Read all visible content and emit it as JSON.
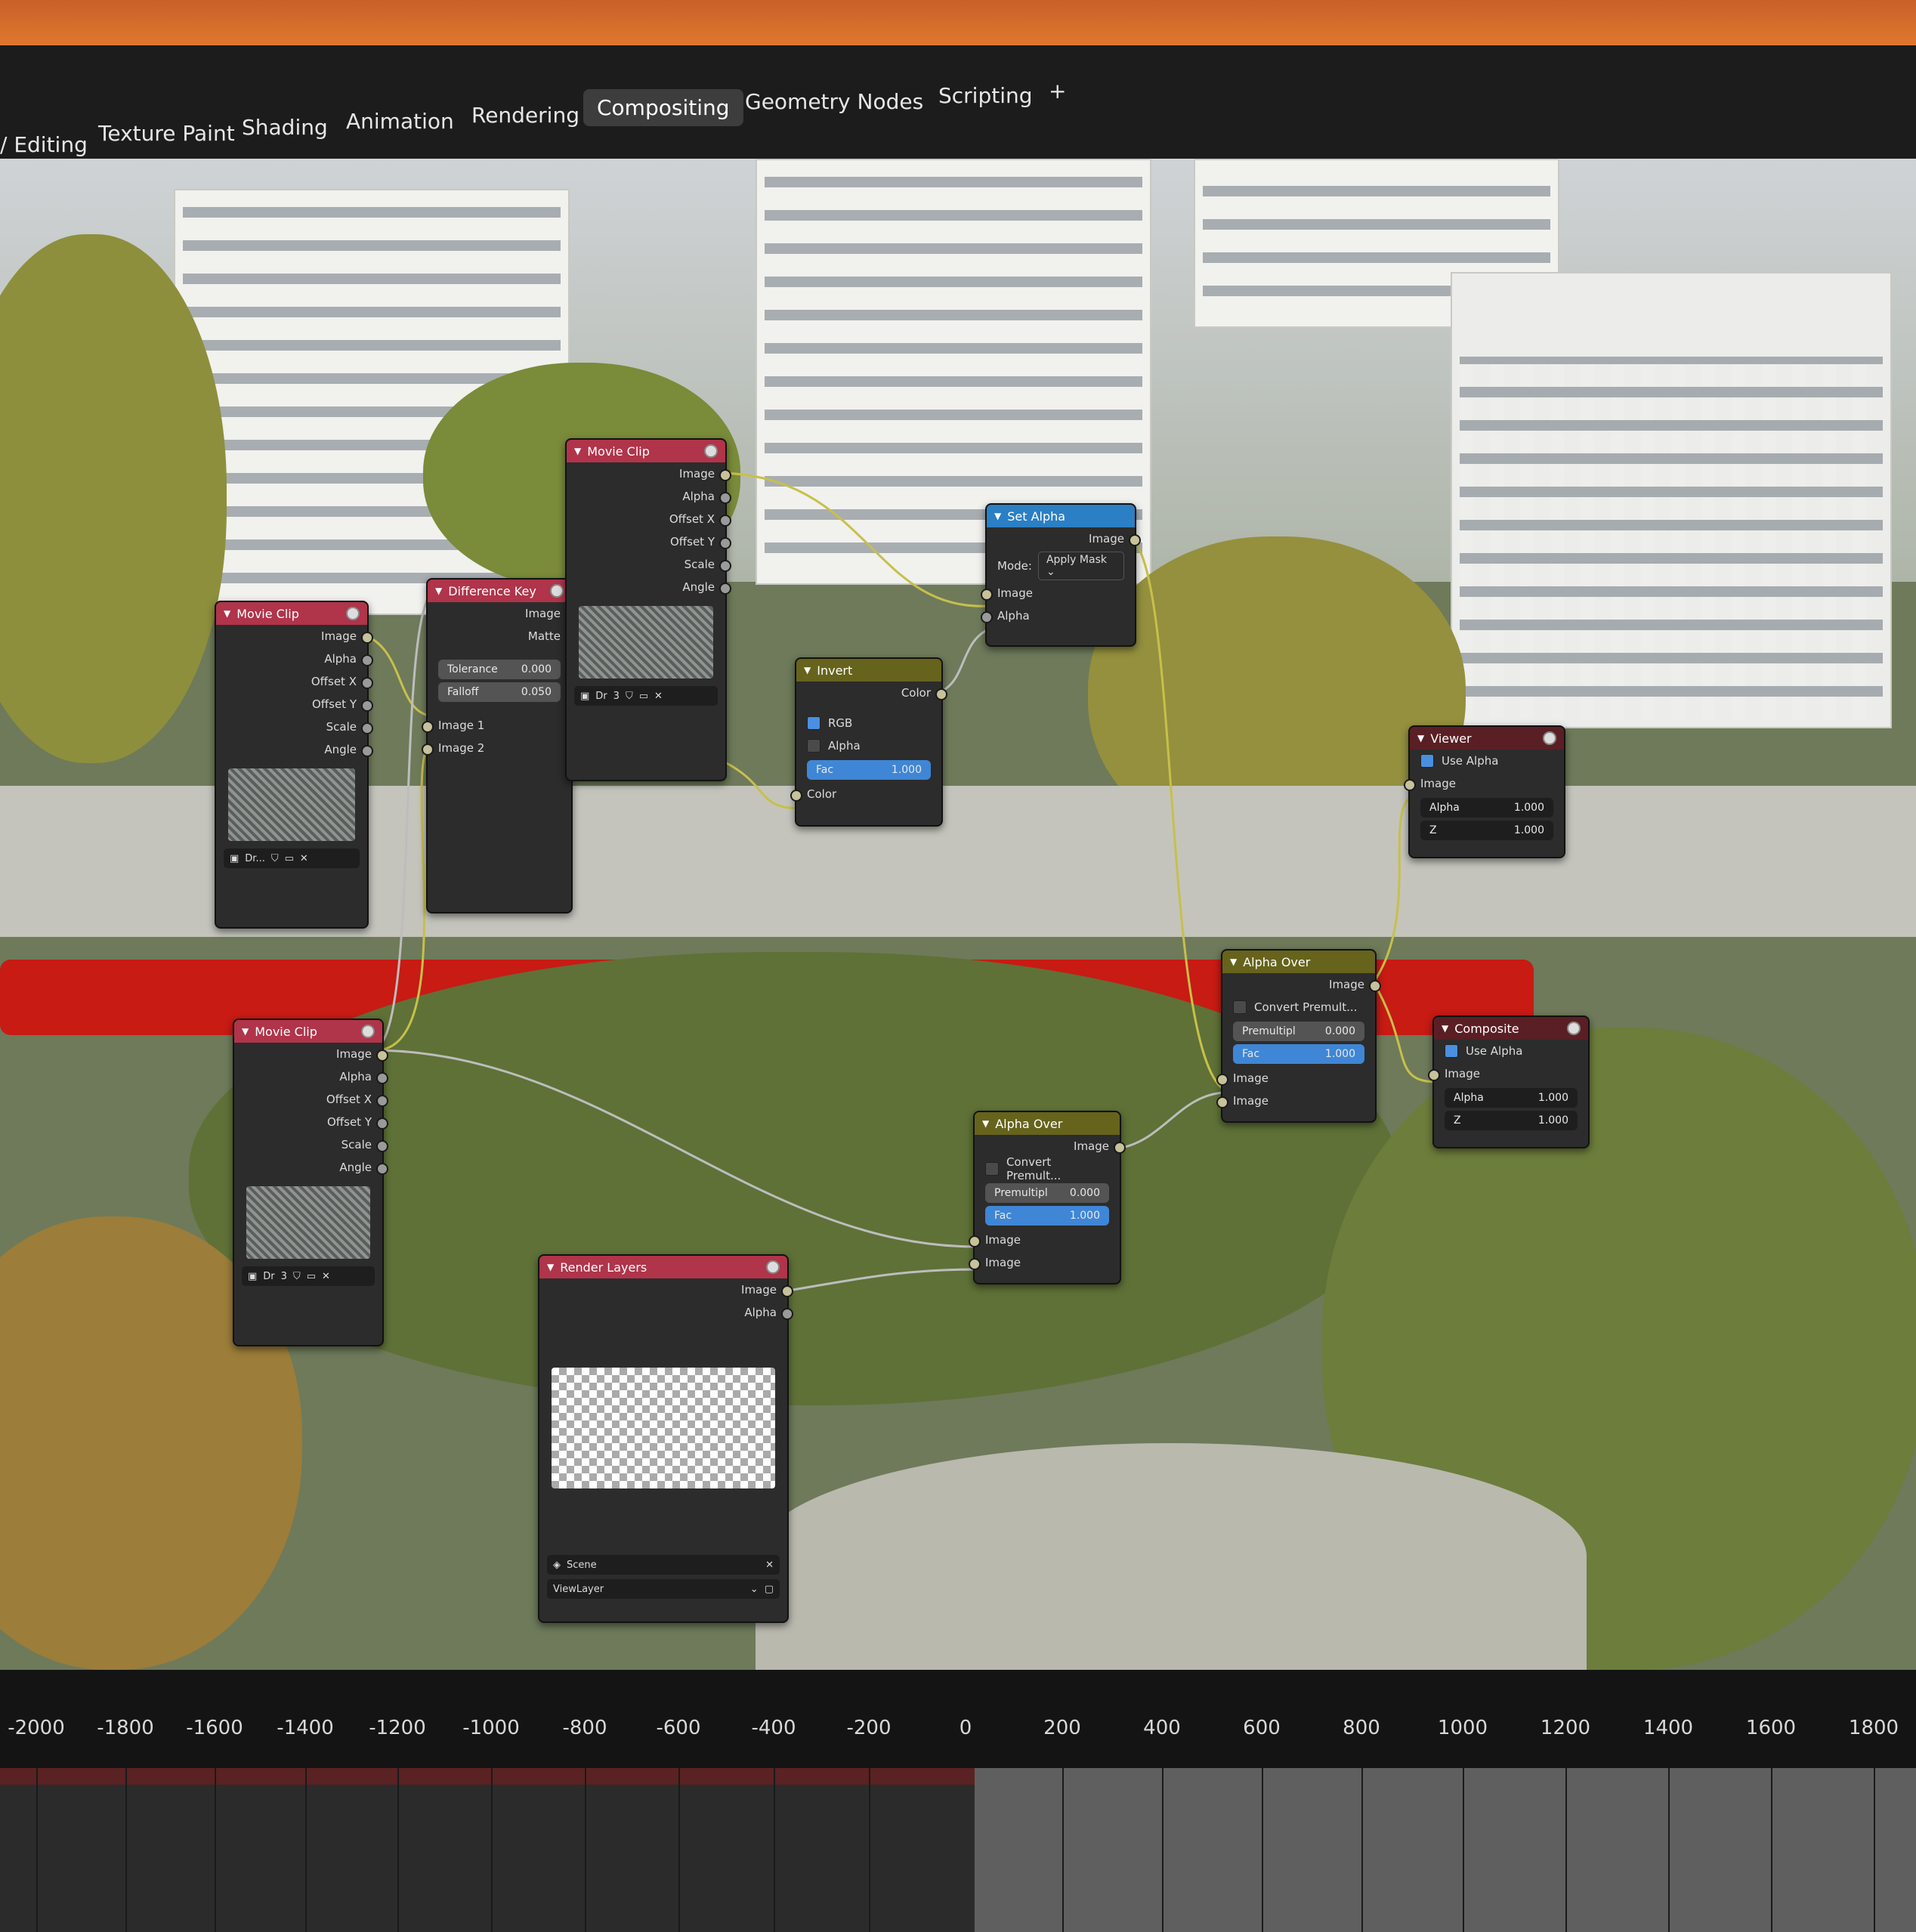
{
  "workspace_tabs": [
    "/ Editing",
    "Texture Paint",
    "Shading",
    "Animation",
    "Rendering",
    "Compositing",
    "Geometry Nodes",
    "Scripting",
    "+"
  ],
  "active_tab": "Compositing",
  "nodes": {
    "movie_clip_1": {
      "title": "Movie Clip",
      "outputs": [
        "Image",
        "Alpha",
        "Offset X",
        "Offset Y",
        "Scale",
        "Angle"
      ],
      "footer": "Dr..."
    },
    "difference_key": {
      "title": "Difference Key",
      "outputs": [
        "Image",
        "Matte"
      ],
      "tolerance_label": "Tolerance",
      "tolerance": "0.000",
      "falloff_label": "Falloff",
      "falloff": "0.050",
      "inputs": [
        "Image 1",
        "Image 2"
      ]
    },
    "movie_clip_2": {
      "title": "Movie Clip",
      "outputs": [
        "Image",
        "Alpha",
        "Offset X",
        "Offset Y",
        "Scale",
        "Angle"
      ],
      "footer": "Dr",
      "users": "3"
    },
    "set_alpha": {
      "title": "Set Alpha",
      "output": "Image",
      "mode_label": "Mode:",
      "mode_value": "Apply Mask",
      "inputs": [
        "Image",
        "Alpha"
      ]
    },
    "invert": {
      "title": "Invert",
      "output": "Color",
      "rgb_label": "RGB",
      "alpha_label": "Alpha",
      "fac_label": "Fac",
      "fac": "1.000",
      "input": "Color"
    },
    "viewer": {
      "title": "Viewer",
      "use_alpha": "Use Alpha",
      "input_image": "Image",
      "alpha_label": "Alpha",
      "alpha": "1.000",
      "z_label": "Z",
      "z": "1.000"
    },
    "alpha_over_1": {
      "title": "Alpha Over",
      "output": "Image",
      "convert": "Convert Premult...",
      "premul_label": "Premultipl",
      "premul": "0.000",
      "fac_label": "Fac",
      "fac": "1.000",
      "inputs": [
        "Image",
        "Image"
      ]
    },
    "composite": {
      "title": "Composite",
      "use_alpha": "Use Alpha",
      "input_image": "Image",
      "alpha_label": "Alpha",
      "alpha": "1.000",
      "z_label": "Z",
      "z": "1.000"
    },
    "movie_clip_3": {
      "title": "Movie Clip",
      "outputs": [
        "Image",
        "Alpha",
        "Offset X",
        "Offset Y",
        "Scale",
        "Angle"
      ],
      "footer": "Dr",
      "users": "3"
    },
    "alpha_over_2": {
      "title": "Alpha Over",
      "output": "Image",
      "convert": "Convert Premult...",
      "premul_label": "Premultipl",
      "premul": "0.000",
      "fac_label": "Fac",
      "fac": "1.000",
      "inputs": [
        "Image",
        "Image"
      ]
    },
    "render_layers": {
      "title": "Render Layers",
      "outputs": [
        "Image",
        "Alpha"
      ],
      "scene": "Scene",
      "view_layer": "ViewLayer"
    }
  },
  "ruler_ticks": [
    "-2000",
    "-1800",
    "-1600",
    "-1400",
    "-1200",
    "-1000",
    "-800",
    "-600",
    "-400",
    "-200",
    "0",
    "200",
    "400",
    "600",
    "800",
    "1000",
    "1200",
    "1400",
    "1600",
    "1800"
  ],
  "colors": {
    "input_header": "#b0344a",
    "converter_header": "#2b7fc4",
    "color_header": "#66631c",
    "output_header": "#5a1f24",
    "link_yellow": "#c7c04a",
    "link_gray": "#bdbdbd"
  }
}
